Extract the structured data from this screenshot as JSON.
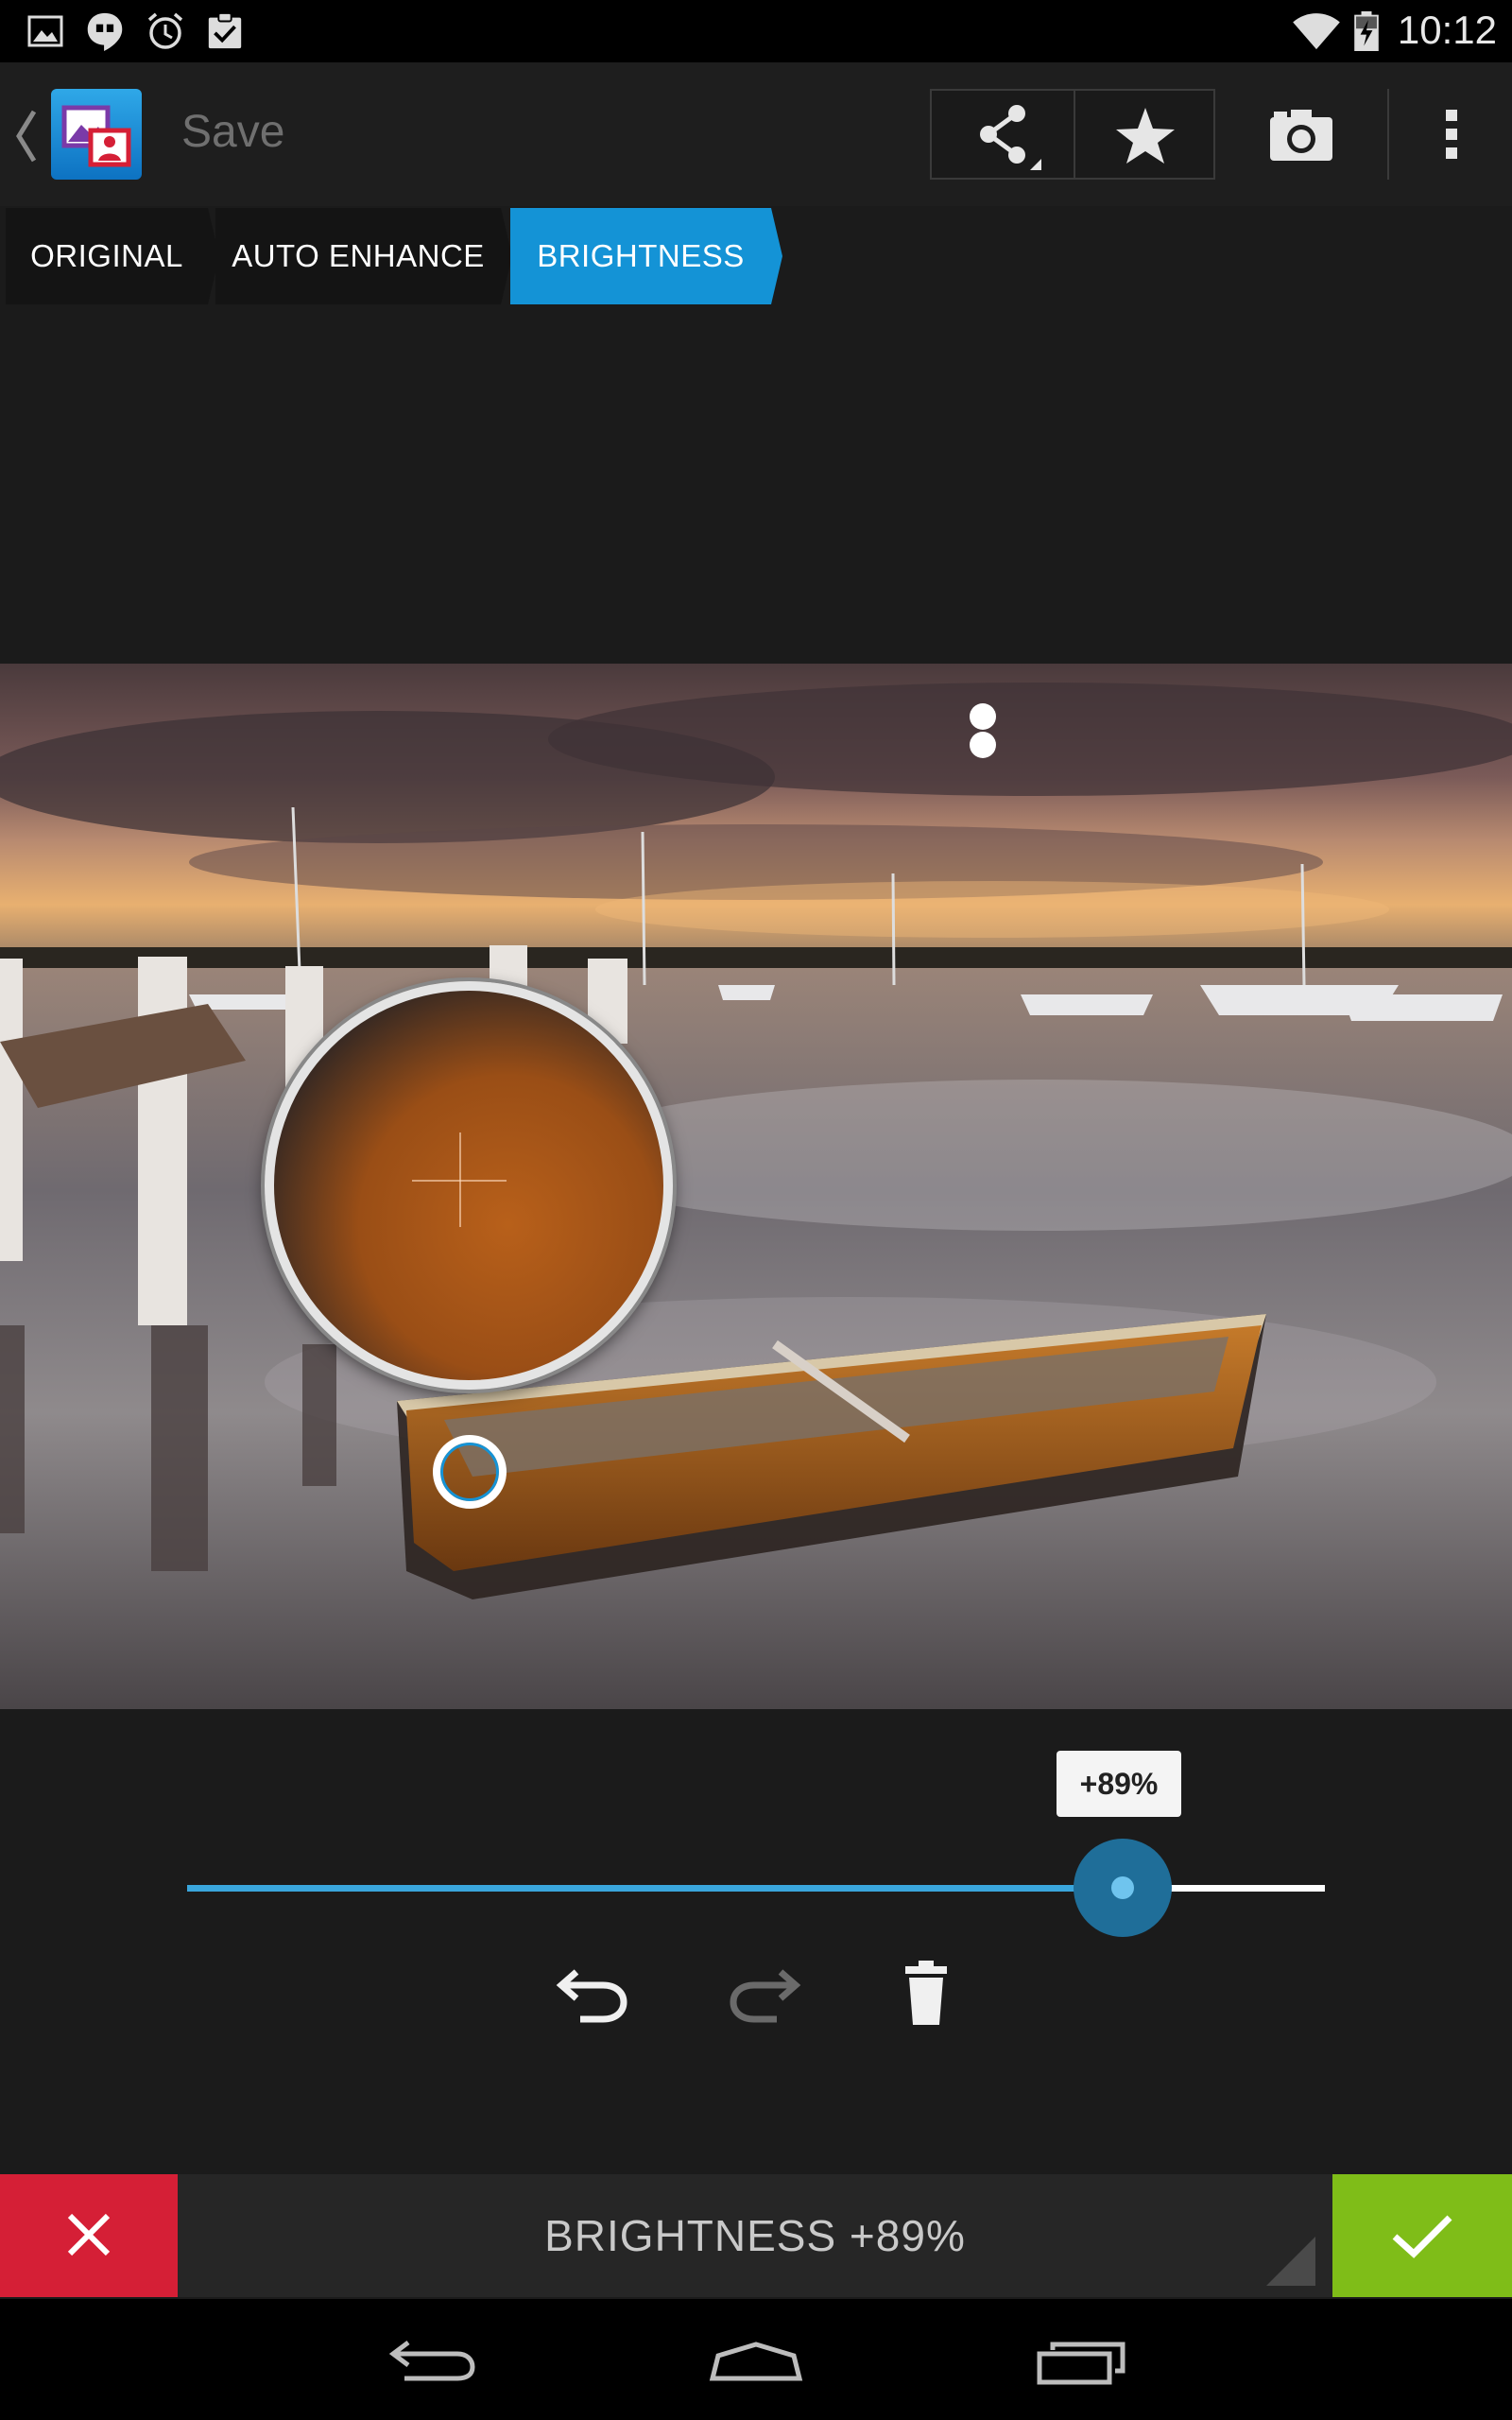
{
  "status_bar": {
    "time": "10:12",
    "left_icons": [
      "image-notification-icon",
      "hangouts-icon",
      "alarm-icon",
      "clipboard-check-icon"
    ],
    "right_icons": [
      "wifi-icon",
      "battery-charging-icon"
    ]
  },
  "action_bar": {
    "save_label": "Save",
    "actions": [
      "share-icon",
      "star-icon",
      "camera-icon",
      "overflow-menu-icon"
    ]
  },
  "steps": [
    {
      "label": "ORIGINAL",
      "active": false
    },
    {
      "label": "AUTO ENHANCE",
      "active": false
    },
    {
      "label": "BRIGHTNESS",
      "active": true
    }
  ],
  "slider": {
    "value_label": "+89%",
    "fraction": 0.822
  },
  "edit_controls": [
    "undo-icon",
    "redo-icon",
    "delete-icon"
  ],
  "bottom_bar": {
    "mode_label": "BRIGHTNESS +89%"
  },
  "colors": {
    "accent_blue": "#1493d6",
    "cancel_red": "#d51f36",
    "apply_green": "#7fbd18"
  }
}
